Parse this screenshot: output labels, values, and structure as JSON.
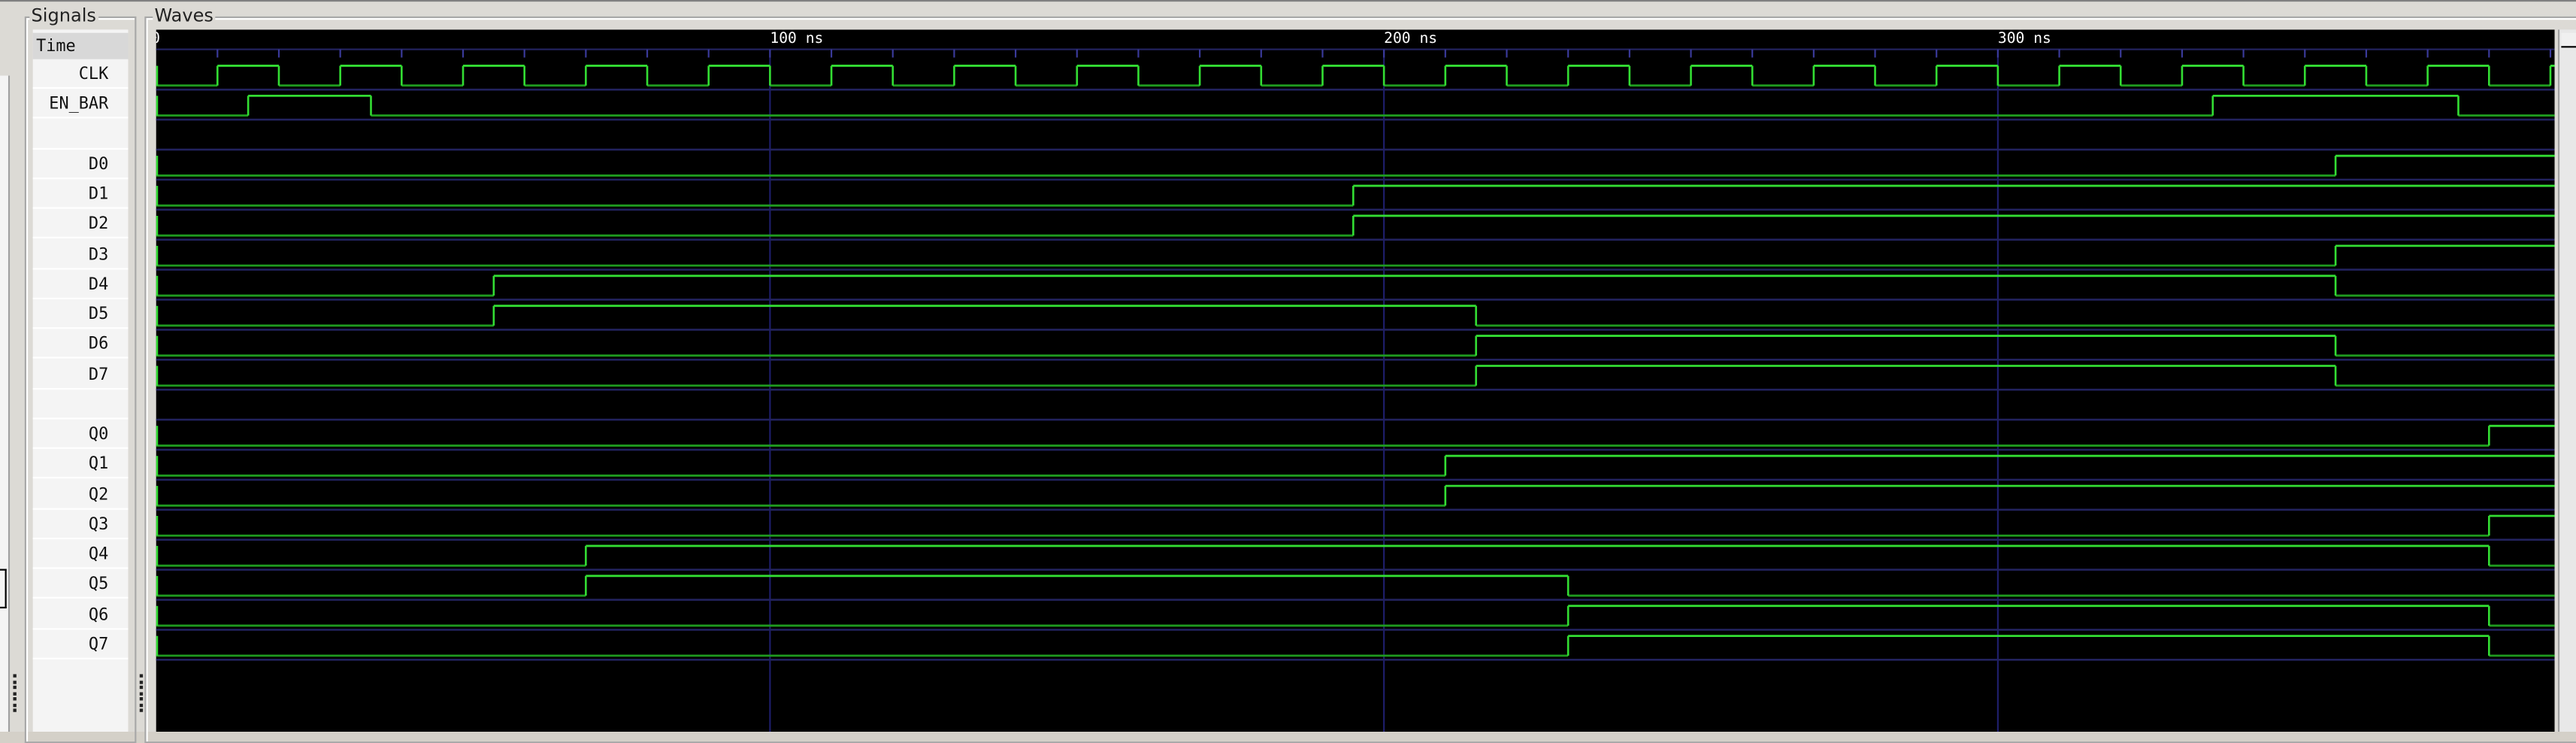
{
  "panels": {
    "signals_title": "Signals",
    "waves_title": "Waves"
  },
  "time_header": "Time",
  "time_axis": {
    "unit": "ns",
    "start": 0,
    "end": 390,
    "major_labels": [
      "0",
      "100 ns",
      "200 ns",
      "300 ns"
    ],
    "major_values": [
      0,
      100,
      200,
      300
    ],
    "minor_tick_step": 10
  },
  "colors": {
    "background": "#000000",
    "wave_high": "#33dd33",
    "wave_low": "#1f9a1f",
    "row_separator": "#22225e",
    "grid": "#1e1e6a"
  },
  "signals": [
    {
      "name": "CLK",
      "clock": {
        "period": 20,
        "first_rise": 10
      }
    },
    {
      "name": "EN_BAR",
      "transitions": [
        [
          0,
          0
        ],
        [
          15,
          1
        ],
        [
          35,
          0
        ],
        [
          335,
          1
        ],
        [
          375,
          0
        ]
      ]
    },
    {
      "name": "",
      "blank": true
    },
    {
      "name": "D0",
      "transitions": [
        [
          0,
          0
        ],
        [
          355,
          1
        ]
      ]
    },
    {
      "name": "D1",
      "transitions": [
        [
          0,
          0
        ],
        [
          195,
          1
        ]
      ]
    },
    {
      "name": "D2",
      "transitions": [
        [
          0,
          0
        ],
        [
          195,
          1
        ]
      ]
    },
    {
      "name": "D3",
      "transitions": [
        [
          0,
          0
        ],
        [
          355,
          1
        ]
      ]
    },
    {
      "name": "D4",
      "transitions": [
        [
          0,
          0
        ],
        [
          55,
          1
        ],
        [
          355,
          0
        ]
      ]
    },
    {
      "name": "D5",
      "transitions": [
        [
          0,
          0
        ],
        [
          55,
          1
        ],
        [
          215,
          0
        ]
      ]
    },
    {
      "name": "D6",
      "transitions": [
        [
          0,
          0
        ],
        [
          215,
          1
        ],
        [
          355,
          0
        ]
      ]
    },
    {
      "name": "D7",
      "transitions": [
        [
          0,
          0
        ],
        [
          215,
          1
        ],
        [
          355,
          0
        ]
      ]
    },
    {
      "name": "",
      "blank": true
    },
    {
      "name": "Q0",
      "transitions": [
        [
          0,
          0
        ],
        [
          380,
          1
        ]
      ]
    },
    {
      "name": "Q1",
      "transitions": [
        [
          0,
          0
        ],
        [
          210,
          1
        ]
      ]
    },
    {
      "name": "Q2",
      "transitions": [
        [
          0,
          0
        ],
        [
          210,
          1
        ]
      ]
    },
    {
      "name": "Q3",
      "transitions": [
        [
          0,
          0
        ],
        [
          380,
          1
        ]
      ]
    },
    {
      "name": "Q4",
      "transitions": [
        [
          0,
          0
        ],
        [
          70,
          1
        ],
        [
          380,
          0
        ]
      ]
    },
    {
      "name": "Q5",
      "transitions": [
        [
          0,
          0
        ],
        [
          70,
          1
        ],
        [
          230,
          0
        ]
      ]
    },
    {
      "name": "Q6",
      "transitions": [
        [
          0,
          0
        ],
        [
          230,
          1
        ],
        [
          380,
          0
        ]
      ]
    },
    {
      "name": "Q7",
      "transitions": [
        [
          0,
          0
        ],
        [
          230,
          1
        ],
        [
          380,
          0
        ]
      ]
    }
  ]
}
